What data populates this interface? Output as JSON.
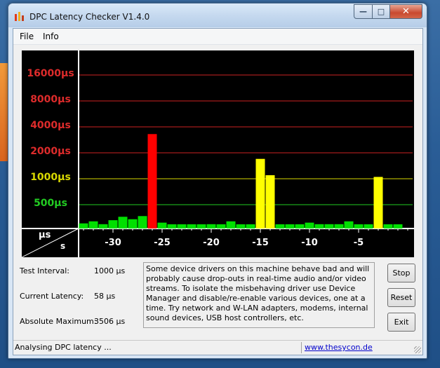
{
  "window": {
    "title": "DPC Latency Checker V1.4.0",
    "controls": {
      "minimize": "—",
      "maximize": "□",
      "close": "✕"
    }
  },
  "menu": [
    "File",
    "Info"
  ],
  "chart_data": {
    "type": "bar",
    "xlabel": "s",
    "ylabel": "µs",
    "y_scale": "log2",
    "y_ticks": [
      {
        "label": "16000µs",
        "value": 16000,
        "color": "#cc2222"
      },
      {
        "label": "8000µs",
        "value": 8000,
        "color": "#cc2222"
      },
      {
        "label": "4000µs",
        "value": 4000,
        "color": "#cc2222"
      },
      {
        "label": "2000µs",
        "value": 2000,
        "color": "#cc2222"
      },
      {
        "label": "1000µs",
        "value": 1000,
        "color": "#d8d800"
      },
      {
        "label": "500µs",
        "value": 500,
        "color": "#22cc22"
      }
    ],
    "x_ticks": [
      {
        "label": "-30",
        "value": -30
      },
      {
        "label": "-25",
        "value": -25
      },
      {
        "label": "-20",
        "value": -20
      },
      {
        "label": "-15",
        "value": -15
      },
      {
        "label": "-10",
        "value": -10
      },
      {
        "label": "-5",
        "value": -5
      }
    ],
    "x_range": [
      -33,
      0
    ],
    "series": [
      {
        "x": [
          -33,
          -32,
          -31,
          -30,
          -29,
          -28,
          -27,
          -26,
          -25,
          -24,
          -23,
          -22,
          -21,
          -20,
          -19,
          -18,
          -17,
          -16,
          -15,
          -14,
          -13,
          -12,
          -11,
          -10,
          -9,
          -8,
          -7,
          -6,
          -5,
          -4,
          -3,
          -2,
          -1
        ],
        "values": [
          55,
          70,
          50,
          80,
          120,
          90,
          130,
          3300,
          60,
          40,
          40,
          40,
          40,
          50,
          45,
          70,
          45,
          45,
          1700,
          1100,
          45,
          45,
          40,
          60,
          50,
          50,
          50,
          70,
          45,
          40,
          1050,
          40,
          40
        ]
      }
    ],
    "bar_colors": {
      "normal": "#00e000",
      "warning": "#ffff00",
      "critical": "#ff0000"
    },
    "thresholds": {
      "warning": 1000,
      "critical": 2000
    },
    "grid": true
  },
  "info": {
    "test_interval_label": "Test Interval:",
    "test_interval_value": "1000 µs",
    "current_latency_label": "Current Latency:",
    "current_latency_value": "58 µs",
    "absolute_maximum_label": "Absolute Maximum:",
    "absolute_maximum_value": "3506 µs"
  },
  "description": "Some device drivers on this machine behave bad and will probably cause drop-outs in real-time audio and/or video streams. To isolate the misbehaving driver use Device Manager and disable/re-enable various devices, one at a time. Try network and W-LAN adapters, modems, internal sound devices, USB host controllers, etc.",
  "buttons": {
    "stop": "Stop",
    "reset": "Reset",
    "exit": "Exit"
  },
  "status": {
    "text": "Analysing DPC latency ...",
    "link": "www.thesycon.de"
  }
}
